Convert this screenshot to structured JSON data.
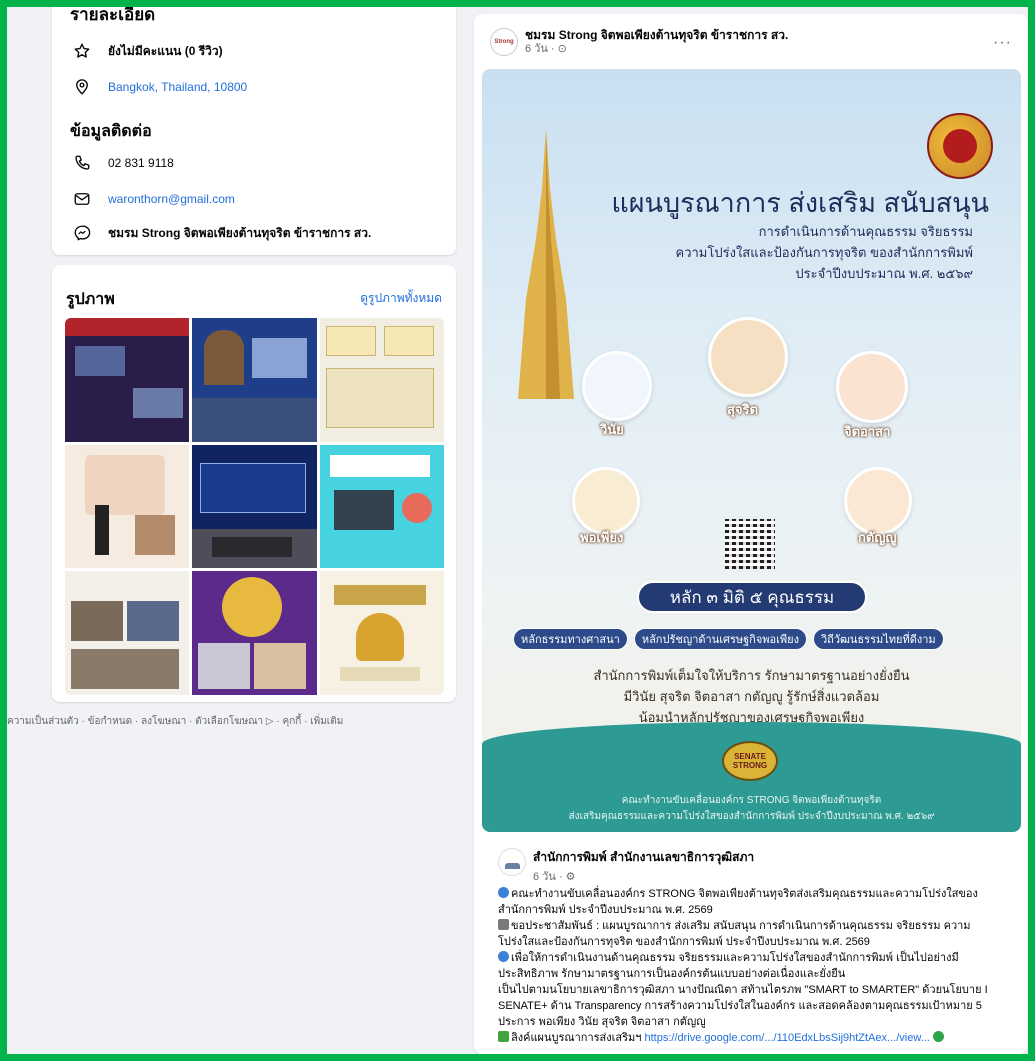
{
  "intro": {
    "heading": "รายละเอียด",
    "rating": "ยังไม่มีคะแนน (0 รีวิว)",
    "location": "Bangkok, Thailand, 10800"
  },
  "contact": {
    "title": "ข้อมูลติดต่อ",
    "phone": "02 831 9118",
    "email": "waronthorn@gmail.com",
    "messenger": "ชมรม Strong จิตพอเพียงต้านทุจริต ข้าราชการ สว."
  },
  "photos": {
    "title": "รูปภาพ",
    "see_all": "ดูรูปภาพทั้งหมด"
  },
  "footer": {
    "links": "ความเป็นส่วนตัว · ข้อกำหนด · ลงโฆษณา · ตัวเลือกโฆษณา ▷ · คุกกี้ · เพิ่มเติม"
  },
  "post": {
    "page_name": "ชมรม Strong จิตพอเพียงต้านทุจริต ข้าราชการ สว.",
    "time": "6 วัน · ⊙",
    "more": "···",
    "avatar_text": "Strong",
    "poster": {
      "title": "แผนบูรณาการ ส่งเสริม สนับสนุน",
      "sub1": "การดำเนินการด้านคุณธรรม จริยธรรม",
      "sub2": "ความโปร่งใสและป้องกันการทุจริต ของสำนักการพิมพ์",
      "sub3": "ประจำปีงบประมาณ พ.ศ. ๒๕๖๙",
      "virtue_1": "วินัย",
      "virtue_2": "สุจริต",
      "virtue_3": "จิตอาสา",
      "virtue_4": "พอเพียง",
      "virtue_5": "กตัญญู",
      "main_pill": "หลัก ๓ มิติ ๕ คุณธรรม",
      "pill_1": "หลักธรรมทางศาสนา",
      "pill_2": "หลักปรัชญาด้านเศรษฐกิจพอเพียง",
      "pill_3": "วิถีวัฒนธรรมไทยที่ดีงาม",
      "body1": "สำนักการพิมพ์เต็มใจให้บริการ รักษามาตรฐานอย่างยั่งยืน",
      "body2": "มีวินัย สุจริต จิตอาสา กตัญญู รู้รักษ์สิ่งแวดล้อม",
      "body3": "น้อมนำหลักปรัชญาของเศรษฐกิจพอเพียง",
      "badge": "SENATE STRONG",
      "teal1": "คณะทำงานขับเคลื่อนองค์กร STRONG จิตพอเพียงต้านทุจริต",
      "teal2": "ส่งเสริมคุณธรรมและความโปร่งใสของสำนักการพิมพ์ ประจำปีงบประมาณ พ.ศ. ๒๕๖๙"
    },
    "shared": {
      "name": "สำนักการพิมพ์ สำนักงานเลขาธิการวุฒิสภา",
      "time": "6 วัน · ⚙",
      "line1": "คณะทำงานขับเคลื่อนองค์กร STRONG จิตพอเพียงต้านทุจริตส่งเสริมคุณธรรมและความโปร่งใสของ",
      "line2": "สำนักการพิมพ์ ประจำปีงบประมาณ พ.ศ. 2569",
      "line3": "ขอประชาสัมพันธ์ : แผนบูรณาการ ส่งเสริม สนับสนุน การดำเนินการด้านคุณธรรม จริยธรรม ความ",
      "line4": "โปร่งใสและป้องกันการทุจริต ของสำนักการพิมพ์ ประจำปีงบประมาณ พ.ศ. 2569",
      "line5": "เพื่อให้การดำเนินงานด้านคุณธรรม จริยธรรมและความโปร่งใสของสำนักการพิมพ์ เป็นไปอย่างมี",
      "line6": "ประสิทธิภาพ รักษามาตรฐานการเป็นองค์กรต้นแบบอย่างต่อเนื่องและยั่งยืน",
      "line7": "เป็นไปตามนโยบายเลขาธิการวุฒิสภา นางปัณณิตา สท้านไตรภพ \"SMART to SMARTER\" ด้วยนโยบาย I",
      "line8": "SENATE+ ด้าน Transparency การสร้างความโปร่งใสในองค์กร และสอดคล้องตามคุณธรรมเป้าหมาย 5",
      "line9": "ประการ  พอเพียง วินัย สุจริต จิตอาสา กตัญญู",
      "link_prefix": "ลิงค์แผนบูรณาการส่งเสริมฯ",
      "link": "https://drive.google.com/.../110EdxLbsSij9htZtAex.../view..."
    }
  },
  "colors": {
    "frame": "#00b34a",
    "link": "#216fdb",
    "poster_navy": "#243a73",
    "teal": "#2e9a94"
  }
}
